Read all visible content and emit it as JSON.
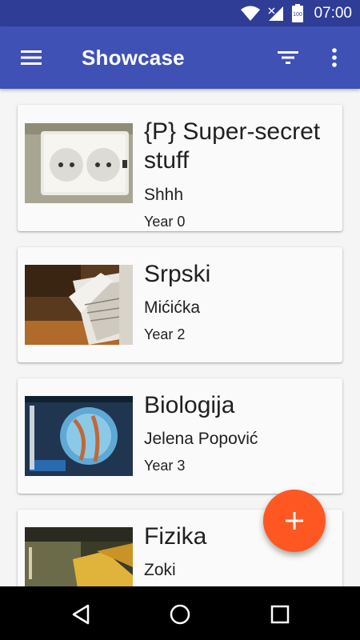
{
  "status_bar": {
    "battery_level": "100",
    "time": "07:00"
  },
  "app_bar": {
    "title": "Showcase",
    "icons": [
      "menu-icon",
      "filter-icon",
      "more-vert-icon"
    ]
  },
  "cards": [
    {
      "title": "{P} Super-secret stuff",
      "subtitle": "Shhh",
      "year": "Year 0",
      "image": "power-socket-photo"
    },
    {
      "title": "Srpski",
      "subtitle": "Mićićka",
      "year": "Year 2",
      "image": "papers-stack-photo"
    },
    {
      "title": "Biologija",
      "subtitle": "Jelena Popović",
      "year": "Year 3",
      "image": "biology-textbook-photo"
    },
    {
      "title": "Fizika",
      "subtitle": "Zoki",
      "year": "",
      "image": "physics-textbook-photo"
    }
  ],
  "fab": {
    "icon": "plus-icon",
    "color": "#ff5722"
  },
  "nav_bar": {
    "icons": [
      "back-icon",
      "home-icon",
      "recents-icon"
    ]
  },
  "colors": {
    "primary": "#3f51b5",
    "primary_dark": "#2f3d97",
    "accent": "#ff5722"
  }
}
